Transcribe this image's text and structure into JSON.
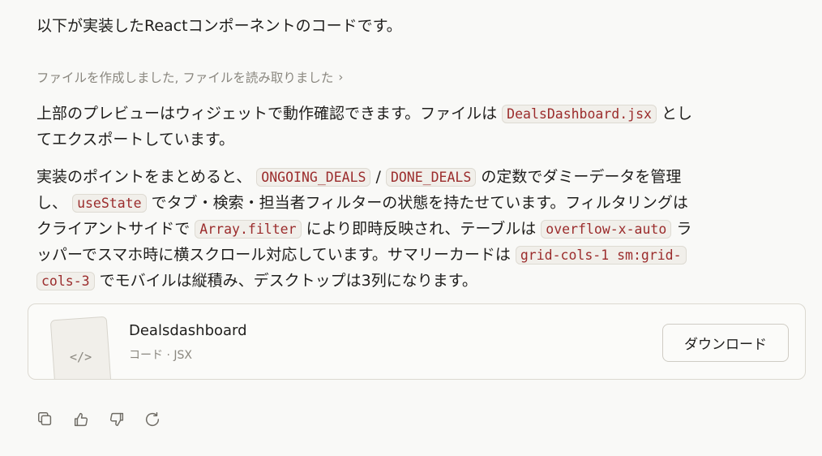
{
  "intro": "以下が実装したReactコンポーネントのコードです。",
  "tool_status": "ファイルを作成しました, ファイルを読み取りました",
  "p1": {
    "l1_a": "上部のプレビューはウィジェットで動作確認できます。ファイルは",
    "l1_code": "DealsDashboard.jsx",
    "l1_b": "とし",
    "l2": "てエクスポートしています。"
  },
  "p2": {
    "l1_a": "実装のポイントをまとめると、",
    "l1_code1": "ONGOING_DEALS",
    "l1_sep": "/",
    "l1_code2": "DONE_DEALS",
    "l1_b": "の定数でダミーデータを管理",
    "l2_a": "し、",
    "l2_code": "useState",
    "l2_b": "でタブ・検索・担当者フィルターの状態を持たせています。フィルタリングは",
    "l3_a": "クライアントサイドで",
    "l3_code": "Array.filter",
    "l3_b": "により即時反映され、テーブルは",
    "l3_code2": "overflow-x-auto",
    "l3_c": "ラ",
    "l4_a": "ッパーでスマホ時に横スクロール対応しています。サマリーカードは",
    "l4_code": "grid-cols-1 sm:grid-",
    "l5_code": "cols-3",
    "l5_b": "でモバイルは縦積み、デスクトップは3列になります。"
  },
  "file_card": {
    "thumb_glyph": "</>",
    "title": "Dealsdashboard",
    "subtitle": "コード · JSX",
    "download_label": "ダウンロード"
  },
  "icons": [
    "copy-icon",
    "thumbs-up-icon",
    "thumbs-down-icon",
    "retry-icon"
  ]
}
